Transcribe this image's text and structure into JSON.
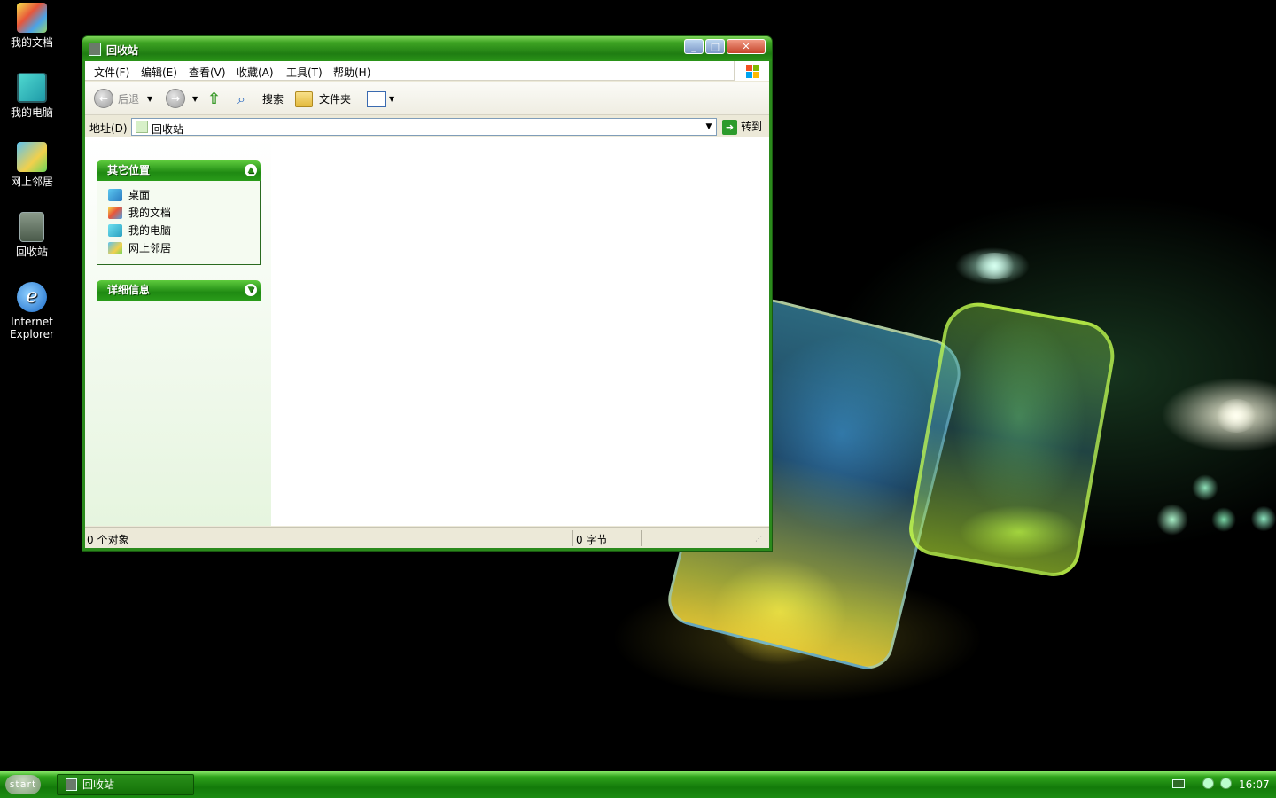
{
  "desktop": {
    "icons": [
      {
        "label": "我的文档",
        "icon": "my-documents-icon"
      },
      {
        "label": "我的电脑",
        "icon": "my-computer-icon"
      },
      {
        "label": "网上邻居",
        "icon": "network-places-icon"
      },
      {
        "label": "回收站",
        "icon": "recycle-bin-icon"
      },
      {
        "label": "Internet Explorer",
        "icon": "internet-explorer-icon"
      }
    ]
  },
  "window": {
    "title": "回收站",
    "menu": {
      "file": "文件(F)",
      "edit": "编辑(E)",
      "view": "查看(V)",
      "favorites": "收藏(A)",
      "tools": "工具(T)",
      "help": "帮助(H)"
    },
    "toolbar": {
      "back": "后退",
      "search": "搜索",
      "folders": "文件夹"
    },
    "address": {
      "label": "地址(D)",
      "value": "回收站",
      "go": "转到"
    },
    "sidebar": {
      "other_places": {
        "title": "其它位置",
        "items": [
          "桌面",
          "我的文档",
          "我的电脑",
          "网上邻居"
        ]
      },
      "details": {
        "title": "详细信息"
      }
    },
    "status": {
      "objects": "0 个对象",
      "size": "0 字节"
    }
  },
  "taskbar": {
    "start": "start",
    "task": "回收站",
    "clock": "16:07"
  },
  "colors": {
    "title_green": "#2b8a1c",
    "panel_green": "#1f8a12",
    "taskbar_green": "#137a0a"
  }
}
